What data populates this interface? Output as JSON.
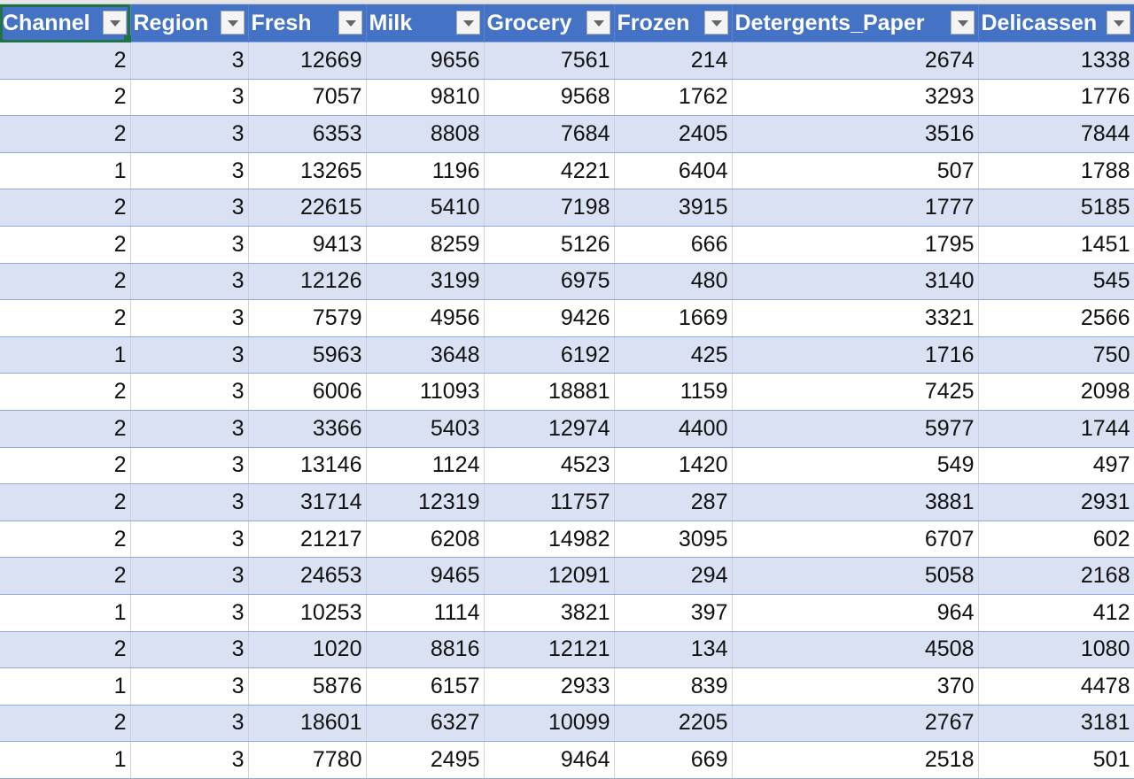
{
  "headers": [
    "Channel",
    "Region",
    "Fresh",
    "Milk",
    "Grocery",
    "Frozen",
    "Detergents_Paper",
    "Delicassen"
  ],
  "rows": [
    [
      2,
      3,
      12669,
      9656,
      7561,
      214,
      2674,
      1338
    ],
    [
      2,
      3,
      7057,
      9810,
      9568,
      1762,
      3293,
      1776
    ],
    [
      2,
      3,
      6353,
      8808,
      7684,
      2405,
      3516,
      7844
    ],
    [
      1,
      3,
      13265,
      1196,
      4221,
      6404,
      507,
      1788
    ],
    [
      2,
      3,
      22615,
      5410,
      7198,
      3915,
      1777,
      5185
    ],
    [
      2,
      3,
      9413,
      8259,
      5126,
      666,
      1795,
      1451
    ],
    [
      2,
      3,
      12126,
      3199,
      6975,
      480,
      3140,
      545
    ],
    [
      2,
      3,
      7579,
      4956,
      9426,
      1669,
      3321,
      2566
    ],
    [
      1,
      3,
      5963,
      3648,
      6192,
      425,
      1716,
      750
    ],
    [
      2,
      3,
      6006,
      11093,
      18881,
      1159,
      7425,
      2098
    ],
    [
      2,
      3,
      3366,
      5403,
      12974,
      4400,
      5977,
      1744
    ],
    [
      2,
      3,
      13146,
      1124,
      4523,
      1420,
      549,
      497
    ],
    [
      2,
      3,
      31714,
      12319,
      11757,
      287,
      3881,
      2931
    ],
    [
      2,
      3,
      21217,
      6208,
      14982,
      3095,
      6707,
      602
    ],
    [
      2,
      3,
      24653,
      9465,
      12091,
      294,
      5058,
      2168
    ],
    [
      1,
      3,
      10253,
      1114,
      3821,
      397,
      964,
      412
    ],
    [
      2,
      3,
      1020,
      8816,
      12121,
      134,
      4508,
      1080
    ],
    [
      1,
      3,
      5876,
      6157,
      2933,
      839,
      370,
      4478
    ],
    [
      2,
      3,
      18601,
      6327,
      10099,
      2205,
      2767,
      3181
    ],
    [
      1,
      3,
      7780,
      2495,
      9464,
      669,
      2518,
      501
    ]
  ],
  "colors": {
    "header": "#4472c4",
    "band": "#d9e1f2",
    "selection": "#217346"
  }
}
